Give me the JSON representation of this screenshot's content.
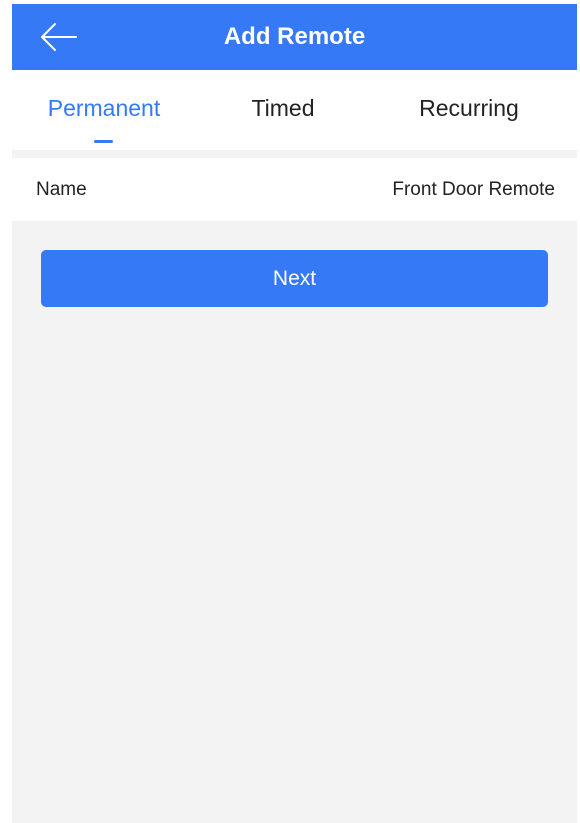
{
  "header": {
    "back_icon": "arrow-left-icon",
    "title": "Add Remote"
  },
  "tabs": [
    {
      "label": "Permanent",
      "active": true
    },
    {
      "label": "Timed",
      "active": false
    },
    {
      "label": "Recurring",
      "active": false
    }
  ],
  "form": {
    "name_label": "Name",
    "name_value": "Front Door Remote"
  },
  "actions": {
    "next_label": "Next"
  },
  "colors": {
    "accent": "#3579f6",
    "background": "#f3f3f3",
    "text": "#222222"
  }
}
